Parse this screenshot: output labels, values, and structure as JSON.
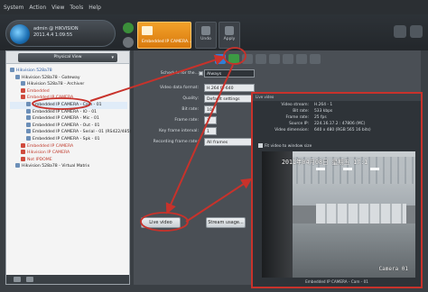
{
  "menu": {
    "items": [
      "System",
      "Action",
      "View",
      "Tools",
      "Help"
    ]
  },
  "server": {
    "name": "admin @ HIKVISION",
    "sub": "2011.4.4 1:09:55"
  },
  "camera_tab": {
    "label": "Embedded IP CAMERA..."
  },
  "toolbar_buttons": {
    "undo": "Undo",
    "apply": "Apply"
  },
  "tree": {
    "view_label": "Physical View",
    "items": [
      {
        "label": "Hikvision 528a78",
        "level": 0,
        "style": "blue"
      },
      {
        "label": "Hikvision 528a78 - Gateway",
        "level": 1,
        "style": "normal"
      },
      {
        "label": "Hikvision 528a78 - Archiver",
        "level": 2,
        "style": "normal"
      },
      {
        "label": "Embedded",
        "level": 2,
        "style": "red"
      },
      {
        "label": "Embedded IP CAMERA",
        "level": 2,
        "style": "red"
      },
      {
        "label": "Embedded IP CAMERA - Cam - 01",
        "level": 3,
        "style": "sel"
      },
      {
        "label": "Embedded IP CAMERA - IO - 01",
        "level": 3,
        "style": "normal"
      },
      {
        "label": "Embedded IP CAMERA - Mic - 01",
        "level": 3,
        "style": "normal"
      },
      {
        "label": "Embedded IP CAMERA - Out - 01",
        "level": 3,
        "style": "normal"
      },
      {
        "label": "Embedded IP CAMERA - Serial - 01 (RS422/485)",
        "level": 3,
        "style": "normal"
      },
      {
        "label": "Embedded IP CAMERA - Spk - 01",
        "level": 3,
        "style": "normal"
      },
      {
        "label": "Embedded IP CAMERA",
        "level": 2,
        "style": "red"
      },
      {
        "label": "Hikvision IP CAMERA",
        "level": 2,
        "style": "red"
      },
      {
        "label": "Not IPDOME",
        "level": 2,
        "style": "red"
      },
      {
        "label": "Hikvision 528a78 - Virtual Matrix",
        "level": 1,
        "style": "normal"
      }
    ]
  },
  "form": {
    "schedule_label": "Schedule for the...",
    "schedule_value": "Always",
    "fields": [
      {
        "label": "Video data format:",
        "value": "H.264 fs-640"
      },
      {
        "label": "Quality:",
        "value": "Default settings"
      },
      {
        "label": "Bit rate:",
        "value": "10"
      },
      {
        "label": "Frame rate:",
        "value": "1"
      },
      {
        "label": "Key frame interval:",
        "value": "1"
      },
      {
        "label": "Recording frame rate:",
        "value": "All frames"
      }
    ],
    "live_button": "Live video",
    "stream_button": "Stream usage..."
  },
  "live_window": {
    "title": "Live video",
    "stats": [
      {
        "key": "Video stream:",
        "value": "H.264 - 1"
      },
      {
        "key": "Bit rate:",
        "value": "533 kbps"
      },
      {
        "key": "Frame rate:",
        "value": "25 fps"
      },
      {
        "key": "Source IP:",
        "value": "224.16.17.2 : 47806 (MC)"
      },
      {
        "key": "Video dimension:",
        "value": "640 x 480 (RGB 565 16 bits)"
      }
    ],
    "fit_label": "Fit video to window size",
    "timestamp": "2011年04月08日 星期五 17:1",
    "camera_label": "Camera 01",
    "footer": "Embedded IP CAMERA - Cam - 01"
  },
  "colors": {
    "accent_red": "#c8322b",
    "camera_tab": "#f2a12a"
  }
}
